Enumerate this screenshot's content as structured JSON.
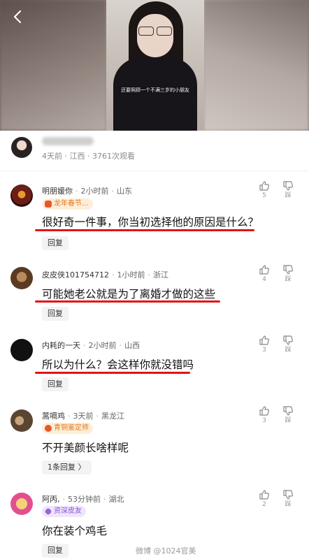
{
  "video": {
    "subtitle": "还要照顾一个不满三岁的小朋友"
  },
  "author": {
    "meta": "4天前 · 江西 · 3761次观看"
  },
  "comments": [
    {
      "name": "明朋媛你",
      "time": "2小时前",
      "location": "山东",
      "badge": "龙年春节...",
      "text": "很好奇一件事，你当初选择他的原因是什么？",
      "reply_label": "回复",
      "likes": "5",
      "dislike_label": "踩"
    },
    {
      "name": "皮皮侠101754712",
      "time": "1小时前",
      "location": "浙江",
      "badge": "",
      "text": "可能她老公就是为了离婚才做的这些",
      "reply_label": "回复",
      "likes": "4",
      "dislike_label": "踩"
    },
    {
      "name": "内耗的一天",
      "time": "2小时前",
      "location": "山西",
      "badge": "",
      "text": "所以为什么？会这样你就没错吗",
      "reply_label": "回复",
      "likes": "3",
      "dislike_label": "踩"
    },
    {
      "name": "蒿嗝鸡",
      "time": "3天前",
      "location": "黑龙江",
      "badge": "青铜鉴定师",
      "text": "不开美颜长啥样呢",
      "reply_label": "1条回复 〉",
      "likes": "3",
      "dislike_label": "踩"
    },
    {
      "name": "阿丙,",
      "time": "53分钟前",
      "location": "湖北",
      "badge": "资深皮友",
      "text": "你在装个鸡毛",
      "reply_label": "回复",
      "likes": "2",
      "dislike_label": "踩"
    }
  ],
  "watermark": "微博 @1024官美",
  "colors": {
    "underline": "#e31313",
    "badge_orange_bg": "#fdeed9",
    "badge_orange_text": "#e07a1f",
    "badge_purple_bg": "#efe6fb",
    "badge_purple_text": "#8a55d4"
  }
}
